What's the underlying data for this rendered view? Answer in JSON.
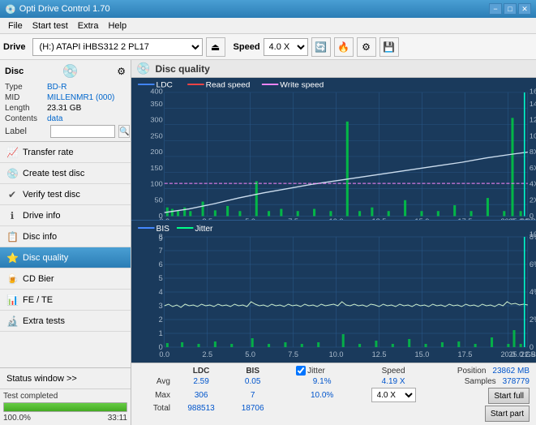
{
  "titlebar": {
    "title": "Opti Drive Control 1.70",
    "icon": "💿",
    "minimize": "−",
    "maximize": "□",
    "close": "✕"
  },
  "menubar": {
    "items": [
      "File",
      "Start test",
      "Extra",
      "Help"
    ]
  },
  "toolbar": {
    "drive_label": "Drive",
    "drive_value": "(H:) ATAPI iHBS312  2 PL17",
    "speed_label": "Speed",
    "speed_value": "4.0 X"
  },
  "disc": {
    "title": "Disc",
    "type_label": "Type",
    "type_value": "BD-R",
    "mid_label": "MID",
    "mid_value": "MILLENMR1 (000)",
    "length_label": "Length",
    "length_value": "23.31 GB",
    "contents_label": "Contents",
    "contents_value": "data",
    "label_label": "Label"
  },
  "nav": {
    "items": [
      {
        "id": "transfer-rate",
        "label": "Transfer rate",
        "icon": "📈"
      },
      {
        "id": "create-test-disc",
        "label": "Create test disc",
        "icon": "💿"
      },
      {
        "id": "verify-test-disc",
        "label": "Verify test disc",
        "icon": "✔"
      },
      {
        "id": "drive-info",
        "label": "Drive info",
        "icon": "ℹ"
      },
      {
        "id": "disc-info",
        "label": "Disc info",
        "icon": "📋"
      },
      {
        "id": "disc-quality",
        "label": "Disc quality",
        "icon": "⭐",
        "active": true
      },
      {
        "id": "cd-bier",
        "label": "CD Bier",
        "icon": "🍺"
      },
      {
        "id": "fe-te",
        "label": "FE / TE",
        "icon": "📊"
      },
      {
        "id": "extra-tests",
        "label": "Extra tests",
        "icon": "🔬"
      }
    ]
  },
  "status": {
    "window_label": "Status window >>",
    "progress_pct": 100,
    "progress_text": "100.0%",
    "time": "33:11",
    "completed": "Test completed"
  },
  "chart": {
    "title": "Disc quality",
    "icon": "💿",
    "legend": {
      "ldc": "LDC",
      "read_speed": "Read speed",
      "write_speed": "Write speed",
      "bis": "BIS",
      "jitter": "Jitter"
    },
    "top_y_max": 400,
    "top_y_right_max": 18,
    "bottom_y_max": 10,
    "bottom_y_right_max": "10%",
    "x_max": 25
  },
  "stats": {
    "headers": [
      "LDC",
      "BIS",
      "",
      "Jitter",
      "Speed"
    ],
    "avg_label": "Avg",
    "avg_ldc": "2.59",
    "avg_bis": "0.05",
    "avg_jitter": "9.1%",
    "avg_speed_label": "4.19 X",
    "speed_select": "4.0 X",
    "max_label": "Max",
    "max_ldc": "306",
    "max_bis": "7",
    "max_jitter": "10.0%",
    "position_label": "Position",
    "position_value": "23862 MB",
    "total_label": "Total",
    "total_ldc": "988513",
    "total_bis": "18706",
    "samples_label": "Samples",
    "samples_value": "378779",
    "start_full": "Start full",
    "start_part": "Start part",
    "jitter_checked": true
  }
}
